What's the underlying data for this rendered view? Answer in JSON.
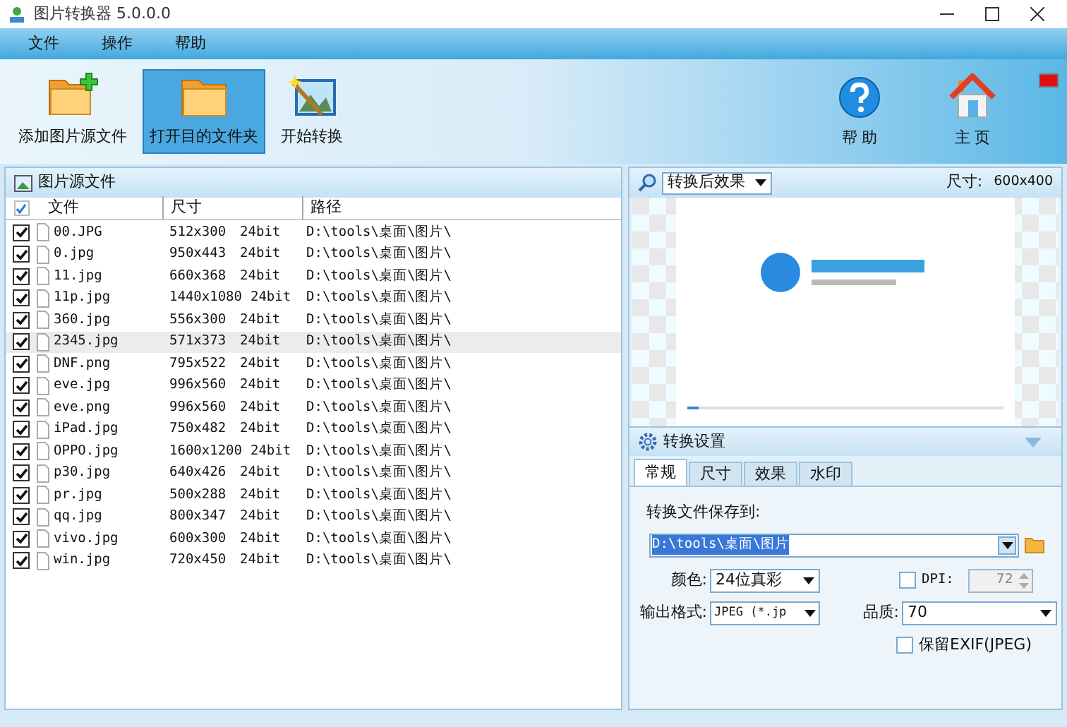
{
  "window": {
    "title": "图片转换器 5.0.0.0"
  },
  "menu": [
    "文件",
    "操作",
    "帮助"
  ],
  "toolbar": [
    {
      "kind": "add",
      "label": "添加图片源文件",
      "selected": false
    },
    {
      "kind": "open",
      "label": "打开目的文件夹",
      "selected": true
    },
    {
      "kind": "convert",
      "label": "开始转换",
      "selected": false
    }
  ],
  "toolbar_right": [
    {
      "kind": "help",
      "label": "帮 助"
    },
    {
      "kind": "home",
      "label": "主 页"
    }
  ],
  "source_panel": {
    "title": "图片源文件",
    "all_checked": true,
    "columns": [
      "文件",
      "尺寸",
      "路径"
    ],
    "rows": [
      {
        "name": "00.JPG",
        "size": "512x300",
        "depth": "24bit",
        "path": "D:\\tools\\桌面\\图片\\",
        "checked": true,
        "selected": false
      },
      {
        "name": "0.jpg",
        "size": "950x443",
        "depth": "24bit",
        "path": "D:\\tools\\桌面\\图片\\",
        "checked": true,
        "selected": false
      },
      {
        "name": "11.jpg",
        "size": "660x368",
        "depth": "24bit",
        "path": "D:\\tools\\桌面\\图片\\",
        "checked": true,
        "selected": false
      },
      {
        "name": "11p.jpg",
        "size": "1440x1080",
        "depth": "24bit",
        "path": "D:\\tools\\桌面\\图片\\",
        "checked": true,
        "selected": false
      },
      {
        "name": "360.jpg",
        "size": "556x300",
        "depth": "24bit",
        "path": "D:\\tools\\桌面\\图片\\",
        "checked": true,
        "selected": false
      },
      {
        "name": "2345.jpg",
        "size": "571x373",
        "depth": "24bit",
        "path": "D:\\tools\\桌面\\图片\\",
        "checked": true,
        "selected": true
      },
      {
        "name": "DNF.png",
        "size": "795x522",
        "depth": "24bit",
        "path": "D:\\tools\\桌面\\图片\\",
        "checked": true,
        "selected": false
      },
      {
        "name": "eve.jpg",
        "size": "996x560",
        "depth": "24bit",
        "path": "D:\\tools\\桌面\\图片\\",
        "checked": true,
        "selected": false
      },
      {
        "name": "eve.png",
        "size": "996x560",
        "depth": "24bit",
        "path": "D:\\tools\\桌面\\图片\\",
        "checked": true,
        "selected": false
      },
      {
        "name": "iPad.jpg",
        "size": "750x482",
        "depth": "24bit",
        "path": "D:\\tools\\桌面\\图片\\",
        "checked": true,
        "selected": false
      },
      {
        "name": "OPPO.jpg",
        "size": "1600x1200",
        "depth": "24bit",
        "path": "D:\\tools\\桌面\\图片\\",
        "checked": true,
        "selected": false
      },
      {
        "name": "p30.jpg",
        "size": "640x426",
        "depth": "24bit",
        "path": "D:\\tools\\桌面\\图片\\",
        "checked": true,
        "selected": false
      },
      {
        "name": "pr.jpg",
        "size": "500x288",
        "depth": "24bit",
        "path": "D:\\tools\\桌面\\图片\\",
        "checked": true,
        "selected": false
      },
      {
        "name": "qq.jpg",
        "size": "800x347",
        "depth": "24bit",
        "path": "D:\\tools\\桌面\\图片\\",
        "checked": true,
        "selected": false
      },
      {
        "name": "vivo.jpg",
        "size": "600x300",
        "depth": "24bit",
        "path": "D:\\tools\\桌面\\图片\\",
        "checked": true,
        "selected": false
      },
      {
        "name": "win.jpg",
        "size": "720x450",
        "depth": "24bit",
        "path": "D:\\tools\\桌面\\图片\\",
        "checked": true,
        "selected": false
      }
    ]
  },
  "preview": {
    "mode": "转换后效果",
    "size_label": "尺寸:",
    "size_value": "600x400"
  },
  "settings": {
    "title": "转换设置",
    "tabs": [
      {
        "label": "常规",
        "selected": true
      },
      {
        "label": "尺寸",
        "selected": false
      },
      {
        "label": "效果",
        "selected": false
      },
      {
        "label": "水印",
        "selected": false
      }
    ],
    "save_label": "转换文件保存到:",
    "save_path": "D:\\tools\\桌面\\图片",
    "color_label": "颜色:",
    "color_value": "24位真彩",
    "format_label": "输出格式:",
    "format_value": "JPEG (*.jp",
    "dpi": {
      "label": "DPI:",
      "checked": false,
      "value": "72",
      "disabled": true
    },
    "quality_label": "品质:",
    "quality_value": "70",
    "exif": {
      "label": "保留EXIF(JPEG)",
      "checked": false
    }
  }
}
